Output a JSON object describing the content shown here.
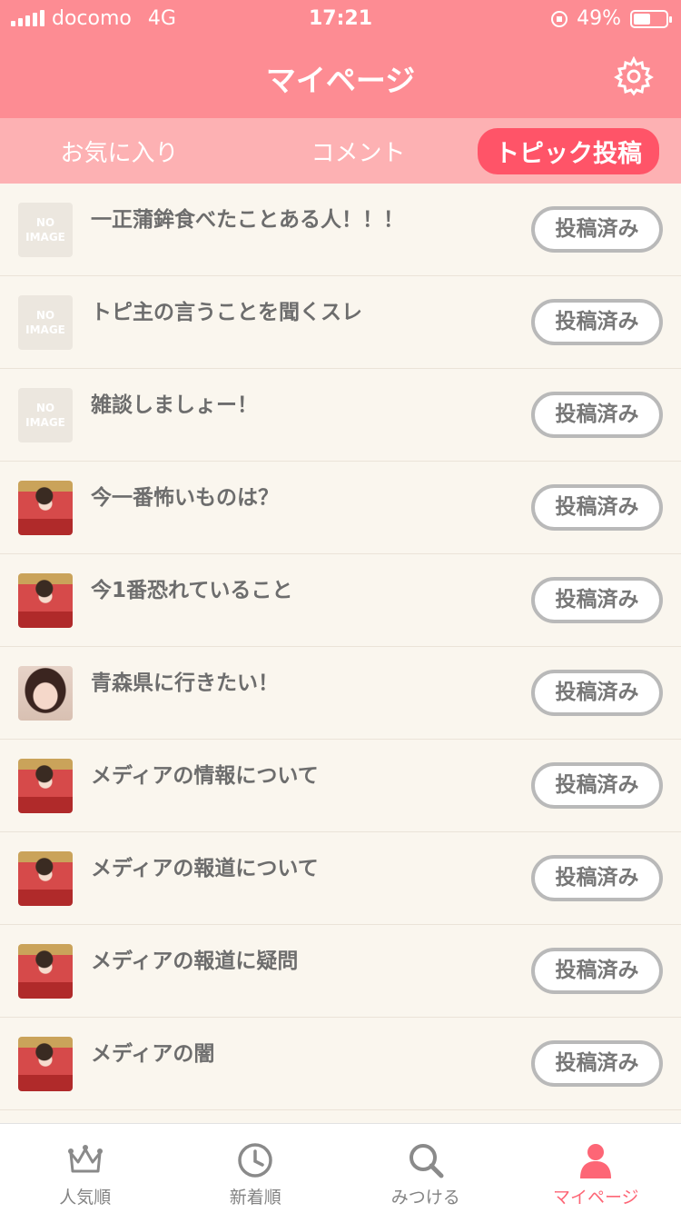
{
  "status_bar": {
    "carrier": "docomo",
    "network": "4G",
    "time": "17:21",
    "battery": "49%"
  },
  "header": {
    "title": "マイページ",
    "settings_icon": "gear-icon"
  },
  "tabs": [
    {
      "label": "お気に入り",
      "active": false
    },
    {
      "label": "コメント",
      "active": false
    },
    {
      "label": "トピック投稿",
      "active": true
    }
  ],
  "topics": [
    {
      "title": "一正蒲鉾食べたことある人！！！",
      "thumb": "no-image",
      "status": "投稿済み"
    },
    {
      "title": "トピ主の言うことを聞くスレ",
      "thumb": "no-image",
      "status": "投稿済み"
    },
    {
      "title": "雑談しましょー！",
      "thumb": "no-image",
      "status": "投稿済み"
    },
    {
      "title": "今一番怖いものは？",
      "thumb": "kimono-photo",
      "status": "投稿済み"
    },
    {
      "title": "今1番恐れていること",
      "thumb": "kimono-photo",
      "status": "投稿済み"
    },
    {
      "title": "青森県に行きたい！",
      "thumb": "portrait-photo",
      "status": "投稿済み"
    },
    {
      "title": "メディアの情報について",
      "thumb": "kimono-photo",
      "status": "投稿済み"
    },
    {
      "title": "メディアの報道について",
      "thumb": "kimono-photo",
      "status": "投稿済み"
    },
    {
      "title": "メディアの報道に疑問",
      "thumb": "kimono-photo",
      "status": "投稿済み"
    },
    {
      "title": "メディアの闇",
      "thumb": "kimono-photo",
      "status": "投稿済み"
    }
  ],
  "no_image_text": "NO IMAGE",
  "tabbar": [
    {
      "label": "人気順",
      "icon": "crown-icon",
      "active": false
    },
    {
      "label": "新着順",
      "icon": "clock-icon",
      "active": false
    },
    {
      "label": "みつける",
      "icon": "search-icon",
      "active": false
    },
    {
      "label": "マイページ",
      "icon": "person-icon",
      "active": true
    }
  ],
  "colors": {
    "header": "#fd8c93",
    "tab_strip": "#fdb1b3",
    "tab_active": "#ff5468",
    "background": "#faf6ee",
    "tabbar_active": "#fd6676"
  }
}
